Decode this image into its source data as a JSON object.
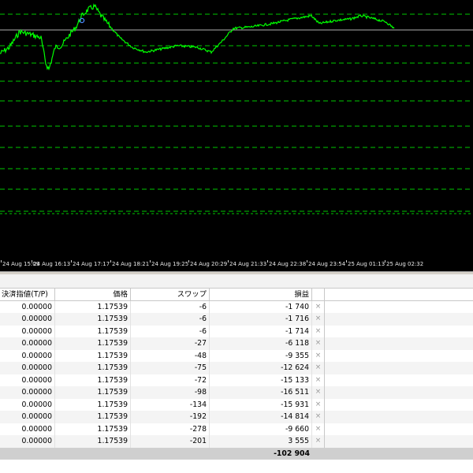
{
  "chart": {
    "colors": {
      "background": "#000000",
      "price_line": "#00ff00",
      "grid": "#00c800",
      "marker": "#4a86ff"
    },
    "time_labels": [
      "24 Aug 15:09",
      "24 Aug 16:13",
      "24 Aug 17:17",
      "24 Aug 18:21",
      "24 Aug 19:25",
      "24 Aug 20:29",
      "24 Aug 21:33",
      "24 Aug 22:38",
      "24 Aug 23:54",
      "25 Aug 01:13",
      "25 Aug 02:32"
    ]
  },
  "table": {
    "columns": {
      "take_profit": "決済指値(T/P)",
      "price": "価格",
      "swap": "スワップ",
      "profit": "損益"
    },
    "close_icon": "×",
    "rows": [
      {
        "take_profit": "0.00000",
        "price": "1.17539",
        "swap": "-6",
        "profit": "-1 740"
      },
      {
        "take_profit": "0.00000",
        "price": "1.17539",
        "swap": "-6",
        "profit": "-1 716"
      },
      {
        "take_profit": "0.00000",
        "price": "1.17539",
        "swap": "-6",
        "profit": "-1 714"
      },
      {
        "take_profit": "0.00000",
        "price": "1.17539",
        "swap": "-27",
        "profit": "-6 118"
      },
      {
        "take_profit": "0.00000",
        "price": "1.17539",
        "swap": "-48",
        "profit": "-9 355"
      },
      {
        "take_profit": "0.00000",
        "price": "1.17539",
        "swap": "-75",
        "profit": "-12 624"
      },
      {
        "take_profit": "0.00000",
        "price": "1.17539",
        "swap": "-72",
        "profit": "-15 133"
      },
      {
        "take_profit": "0.00000",
        "price": "1.17539",
        "swap": "-98",
        "profit": "-16 511"
      },
      {
        "take_profit": "0.00000",
        "price": "1.17539",
        "swap": "-134",
        "profit": "-15 931"
      },
      {
        "take_profit": "0.00000",
        "price": "1.17539",
        "swap": "-192",
        "profit": "-14 814"
      },
      {
        "take_profit": "0.00000",
        "price": "1.17539",
        "swap": "-278",
        "profit": "-9 660"
      },
      {
        "take_profit": "0.00000",
        "price": "1.17539",
        "swap": "-201",
        "profit": "3 555"
      }
    ],
    "total_profit": "-102 904"
  }
}
